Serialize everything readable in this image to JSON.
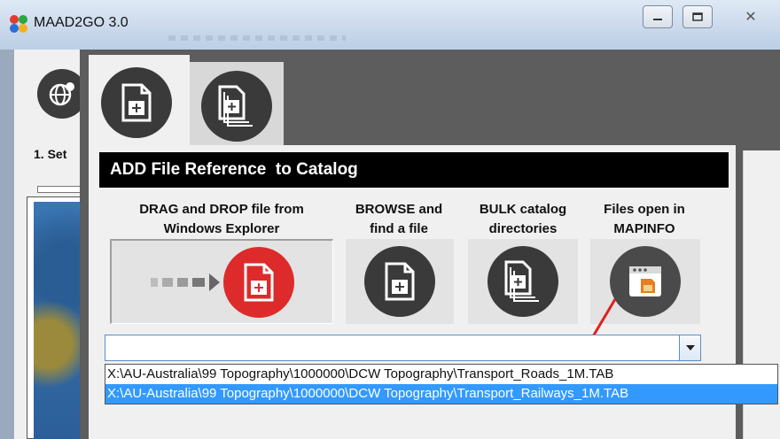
{
  "window": {
    "title": "MAAD2GO 3.0",
    "close_glyph": "✕"
  },
  "sidebar": {
    "step_label": "1. Set"
  },
  "dialog": {
    "header": "ADD File Reference  to Catalog",
    "options": [
      {
        "label_line1": "DRAG and DROP file from",
        "label_line2": "Windows Explorer",
        "icon": "drag-drop-file-icon"
      },
      {
        "label_line1": "BROWSE and",
        "label_line2": "find a file",
        "icon": "add-file-icon"
      },
      {
        "label_line1": "BULK catalog",
        "label_line2": "directories",
        "icon": "add-multiple-files-icon"
      },
      {
        "label_line1": "Files open in",
        "label_line2": "MAPINFO",
        "icon": "mapinfo-window-icon"
      }
    ],
    "combo": {
      "value": ""
    },
    "dropdown_items": [
      "X:\\AU-Australia\\99 Topography\\1000000\\DCW Topography\\Transport_Roads_1M.TAB",
      "X:\\AU-Australia\\99 Topography\\1000000\\DCW Topography\\Transport_Railways_1M.TAB"
    ],
    "selected_index": 1
  },
  "colors": {
    "header_bg": "#000000",
    "drag_circle": "#dd2b2b",
    "selection": "#3399ff",
    "arrow": "#e02020"
  }
}
